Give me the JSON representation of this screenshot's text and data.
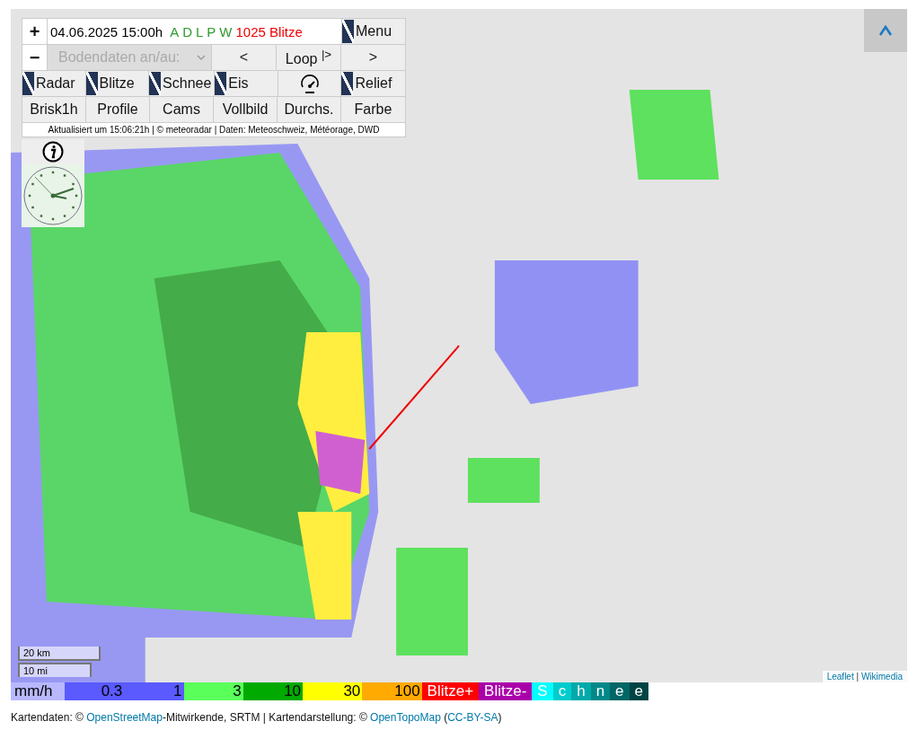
{
  "controls": {
    "zoom_in": "+",
    "zoom_out": "−",
    "timestamp": "04.06.2025 15:00h",
    "sources": [
      {
        "label": "A",
        "color": "#2e9a2e"
      },
      {
        "label": "D",
        "color": "#2e9a2e"
      },
      {
        "label": "L",
        "color": "#2e9a2e"
      },
      {
        "label": "P",
        "color": "#2e9a2e"
      },
      {
        "label": "W",
        "color": "#2e9a2e"
      }
    ],
    "lightning_count": "1025 Blitze",
    "menu": {
      "label": "Menu",
      "checked": true
    },
    "dropdown": {
      "value": "Bodendaten an/au:",
      "disabled": true
    },
    "nav": [
      {
        "label": "<"
      },
      {
        "label": "Loop $^{|>}$"
      },
      {
        "label": ">"
      }
    ],
    "toggles": [
      {
        "kind": "check",
        "label": "Radar",
        "checked": true
      },
      {
        "kind": "check",
        "label": "Blitze",
        "checked": true
      },
      {
        "kind": "check",
        "label": "Schnee",
        "checked": true
      },
      {
        "kind": "check",
        "label": "Eis",
        "checked": true
      },
      {
        "kind": "gauge"
      },
      {
        "kind": "check",
        "label": "Relief",
        "checked": true
      }
    ],
    "buttons": [
      "Brisk1h",
      "Profile",
      "Cams",
      "Vollbild",
      "Durchs.",
      "Farbe"
    ],
    "credit": "Aktualisiert um 15:06:21h | © meteoradar | Daten: Meteoschweiz, Météorage, DWD"
  },
  "scale": [
    "20 km",
    "10 mi"
  ],
  "attribution": [
    {
      "text": "Leaflet",
      "link": true
    },
    {
      "text": " | ",
      "link": false
    },
    {
      "text": "Wikimedia",
      "link": true
    }
  ],
  "legend": [
    {
      "kind": "unit",
      "label": "mm/h",
      "color": "#b8b8ff"
    },
    {
      "kind": "value",
      "label": "0.3",
      "color": "#5a5aff"
    },
    {
      "kind": "value",
      "label": "1",
      "color": "#5a5aff"
    },
    {
      "kind": "value",
      "label": "3",
      "color": "#5aff5a"
    },
    {
      "kind": "value",
      "label": "10",
      "color": "#00aa00"
    },
    {
      "kind": "value",
      "label": "30",
      "color": "#ffff00"
    },
    {
      "kind": "value",
      "label": "100",
      "color": "#ffaa00"
    },
    {
      "kind": "label",
      "label": "Blitze+",
      "color": "#ff0000"
    },
    {
      "kind": "label",
      "label": "Blitze-",
      "color": "#aa00aa"
    },
    {
      "kind": "label",
      "label": "S",
      "color": "#00ffff"
    },
    {
      "kind": "label",
      "label": "c",
      "color": "#00cccc"
    },
    {
      "kind": "label",
      "label": "h",
      "color": "#00aaaa"
    },
    {
      "kind": "label",
      "label": "n",
      "color": "#008888"
    },
    {
      "kind": "label",
      "label": "e",
      "color": "#006666"
    },
    {
      "kind": "label",
      "label": "e",
      "color": "#004444"
    }
  ],
  "footer": [
    {
      "text": "Kartendaten: © ",
      "link": false
    },
    {
      "text": "OpenStreetMap",
      "link": true
    },
    {
      "text": "-Mitwirkende, SRTM | Kartendarstellung: © ",
      "link": false
    },
    {
      "text": "OpenTopoMap",
      "link": true
    },
    {
      "text": " (",
      "link": false
    },
    {
      "text": "CC-BY-SA",
      "link": true
    },
    {
      "text": ")",
      "link": false
    }
  ]
}
